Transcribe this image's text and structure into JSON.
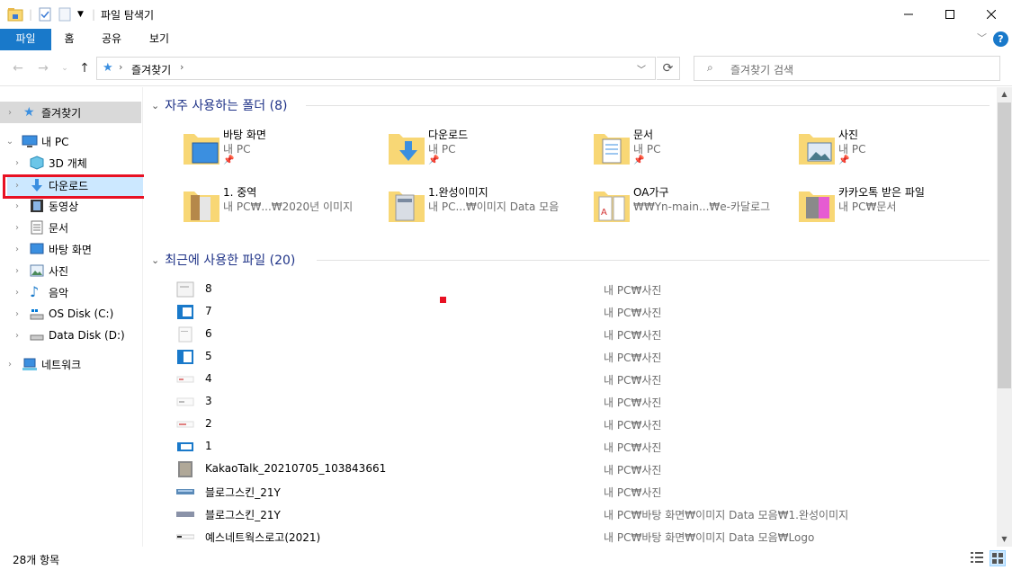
{
  "window": {
    "title": "파일 탐색기"
  },
  "ribbon": {
    "tabs": [
      "파일",
      "홈",
      "공유",
      "보기"
    ]
  },
  "address": {
    "path": "즐겨찾기"
  },
  "search": {
    "placeholder": "즐겨찾기 검색"
  },
  "sidebar": {
    "items": [
      {
        "label": "즐겨찾기",
        "icon": "star-icon"
      },
      {
        "label": "내 PC",
        "icon": "computer-icon"
      },
      {
        "label": "3D 개체",
        "icon": "3d-objects-icon"
      },
      {
        "label": "다운로드",
        "icon": "download-icon"
      },
      {
        "label": "동영상",
        "icon": "video-icon"
      },
      {
        "label": "문서",
        "icon": "document-icon"
      },
      {
        "label": "바탕 화면",
        "icon": "desktop-icon"
      },
      {
        "label": "사진",
        "icon": "pictures-icon"
      },
      {
        "label": "음악",
        "icon": "music-icon"
      },
      {
        "label": "OS Disk (C:)",
        "icon": "drive-c-icon"
      },
      {
        "label": "Data Disk (D:)",
        "icon": "drive-d-icon"
      },
      {
        "label": "네트워크",
        "icon": "network-icon"
      }
    ]
  },
  "frequent": {
    "heading": "자주 사용하는 폴더 (8)",
    "folders": [
      {
        "name": "바탕 화면",
        "location": "내 PC",
        "icon": "desktop-folder-icon"
      },
      {
        "name": "다운로드",
        "location": "내 PC",
        "icon": "downloads-folder-icon"
      },
      {
        "name": "문서",
        "location": "내 PC",
        "icon": "documents-folder-icon"
      },
      {
        "name": "사진",
        "location": "내 PC",
        "icon": "pictures-folder-icon"
      },
      {
        "name": "1. 중역",
        "location": "내 PC₩...₩2020년 이미지",
        "icon": "folder-icon"
      },
      {
        "name": "1.완성이미지",
        "location": "내 PC...₩이미지 Data 모음",
        "icon": "folder-icon"
      },
      {
        "name": "OA가구",
        "location": "₩₩Yn-main...₩e-카달로그",
        "icon": "pdf-folder-icon"
      },
      {
        "name": "카카오톡 받은 파일",
        "location": "내 PC₩문서",
        "icon": "folder-icon"
      }
    ]
  },
  "recent": {
    "heading": "최근에 사용한 파일 (20)",
    "files": [
      {
        "name": "8",
        "path": "내 PC₩사진"
      },
      {
        "name": "7",
        "path": "내 PC₩사진"
      },
      {
        "name": "6",
        "path": "내 PC₩사진"
      },
      {
        "name": "5",
        "path": "내 PC₩사진"
      },
      {
        "name": "4",
        "path": "내 PC₩사진"
      },
      {
        "name": "3",
        "path": "내 PC₩사진"
      },
      {
        "name": "2",
        "path": "내 PC₩사진"
      },
      {
        "name": "1",
        "path": "내 PC₩사진"
      },
      {
        "name": "KakaoTalk_20210705_103843661",
        "path": "내 PC₩사진"
      },
      {
        "name": "블로그스킨_21Y",
        "path": "내 PC₩사진"
      },
      {
        "name": "블로그스킨_21Y",
        "path": "내 PC₩바탕 화면₩이미지 Data 모음₩1.완성이미지"
      },
      {
        "name": "예스네트웍스로고(2021)",
        "path": "내 PC₩바탕 화면₩이미지 Data 모음₩Logo"
      }
    ]
  },
  "status": {
    "count": "28개 항목"
  },
  "colors": {
    "accent": "#1979ca",
    "highlight": "#e81123",
    "folder": "#f8d775",
    "selected": "#cce8ff"
  }
}
